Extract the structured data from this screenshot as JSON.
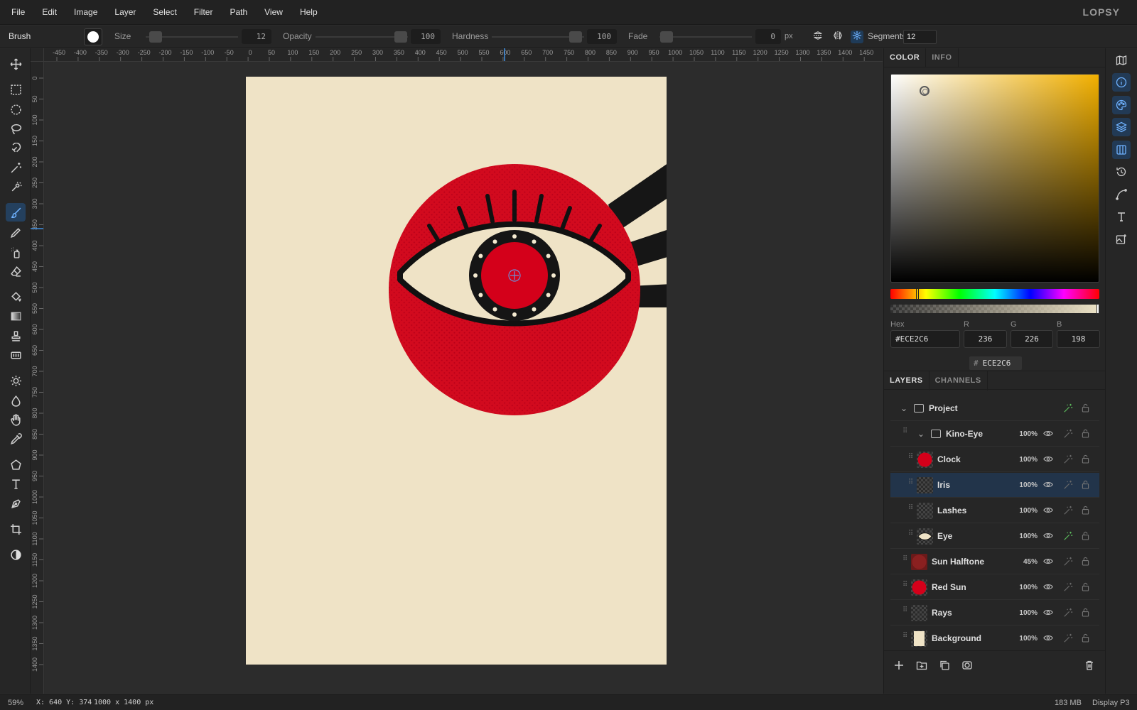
{
  "app": {
    "logo": "LOPSY"
  },
  "menu": [
    "File",
    "Edit",
    "Image",
    "Layer",
    "Select",
    "Filter",
    "Path",
    "View",
    "Help"
  ],
  "options_bar": {
    "tool_name": "Brush",
    "size_label": "Size",
    "size_value": "12",
    "opacity_label": "Opacity",
    "opacity_value": "100",
    "hardness_label": "Hardness",
    "hardness_value": "100",
    "fade_label": "Fade",
    "fade_value": "0",
    "fade_unit": "px",
    "segments_label": "Segments",
    "segments_value": "12",
    "symmetry_icons": [
      "symmetry-vertical-icon",
      "symmetry-horizontal-icon",
      "symmetry-radial-icon"
    ]
  },
  "tools": [
    "move-icon",
    "rect-select-icon",
    "ellipse-select-icon",
    "lasso-icon",
    "magnetic-lasso-icon",
    "magic-wand-icon",
    "quick-select-icon",
    "brush-icon",
    "pencil-icon",
    "spray-icon",
    "eraser-icon",
    "bucket-icon",
    "gradient-icon",
    "stamp-icon",
    "pattern-icon",
    "dodge-icon",
    "blur-drop-icon",
    "smudge-hand-icon",
    "eyedropper-icon",
    "polygon-icon",
    "text-icon",
    "pen-icon",
    "crop-icon",
    "contrast-icon"
  ],
  "ruler": {
    "h_labels": [
      "-450",
      "-400",
      "-350",
      "-300",
      "-250",
      "-200",
      "-150",
      "-100",
      "-50",
      "0",
      "50",
      "100",
      "150",
      "200",
      "250",
      "300",
      "350",
      "400",
      "450",
      "500",
      "550",
      "600",
      "650",
      "700",
      "750",
      "800",
      "850",
      "900",
      "950",
      "1000",
      "1050",
      "1100",
      "1150",
      "1200",
      "1250",
      "1300",
      "1350",
      "1400",
      "1450"
    ],
    "v_labels": [
      "0",
      "50",
      "100",
      "150",
      "200",
      "250",
      "300",
      "350",
      "400",
      "450",
      "500",
      "550",
      "600",
      "650",
      "700",
      "750",
      "800",
      "850",
      "900",
      "950",
      "1000",
      "1050",
      "1100",
      "1150",
      "1200",
      "1250",
      "1300",
      "1350",
      "1400"
    ]
  },
  "color_panel": {
    "tabs": [
      "COLOR",
      "INFO"
    ],
    "hex_label": "Hex",
    "hex_value": "#ECE2C6",
    "r_label": "R",
    "r_value": "236",
    "g_label": "G",
    "g_value": "226",
    "b_label": "B",
    "b_value": "198",
    "chip_hash": "#",
    "chip_value": "ECE2C6",
    "color": "#ECE2C6"
  },
  "layers_panel": {
    "tabs": [
      "LAYERS",
      "CHANNELS"
    ],
    "layers": [
      {
        "name": "Project",
        "opacity": "",
        "type": "group",
        "depth": 0,
        "fx": true,
        "visible_icon": false
      },
      {
        "name": "Kino-Eye",
        "opacity": "100%",
        "type": "group",
        "depth": 1,
        "fx": false,
        "visible_icon": true
      },
      {
        "name": "Clock",
        "opacity": "100%",
        "type": "layer",
        "depth": 2,
        "fx": false,
        "thumb": "red-circle",
        "visible_icon": true
      },
      {
        "name": "Iris",
        "opacity": "100%",
        "type": "layer",
        "depth": 2,
        "fx": false,
        "thumb": "transparent",
        "selected": true,
        "visible_icon": true
      },
      {
        "name": "Lashes",
        "opacity": "100%",
        "type": "layer",
        "depth": 2,
        "fx": false,
        "thumb": "transparent",
        "visible_icon": true
      },
      {
        "name": "Eye",
        "opacity": "100%",
        "type": "layer",
        "depth": 2,
        "fx": true,
        "thumb": "eye-shape",
        "visible_icon": true
      },
      {
        "name": "Sun Halftone",
        "opacity": "45%",
        "type": "layer",
        "depth": 1,
        "fx": false,
        "thumb": "halftone",
        "visible_icon": true
      },
      {
        "name": "Red Sun",
        "opacity": "100%",
        "type": "layer",
        "depth": 1,
        "fx": false,
        "thumb": "red-circle",
        "visible_icon": true
      },
      {
        "name": "Rays",
        "opacity": "100%",
        "type": "layer",
        "depth": 1,
        "fx": false,
        "thumb": "transparent",
        "visible_icon": true
      },
      {
        "name": "Background",
        "opacity": "100%",
        "type": "layer",
        "depth": 1,
        "fx": false,
        "thumb": "cream",
        "visible_icon": true
      }
    ],
    "footer_icons": [
      "add-layer-icon",
      "add-folder-icon",
      "duplicate-layer-icon",
      "mask-icon",
      "delete-layer-icon"
    ]
  },
  "right_strip": [
    "map-icon",
    "info-icon",
    "palette-icon",
    "layers-icon",
    "columns-icon",
    "history-icon",
    "curve-icon",
    "type-icon",
    "image-add-icon"
  ],
  "status": {
    "zoom": "59%",
    "coords": "X: 640 Y: 374",
    "doc_size": "1000 x 1400 px",
    "memory": "183 MB",
    "profile": "Display P3"
  },
  "colors": {
    "accent": "#4a9eff",
    "canvas": "#efe3c6",
    "sun_red": "#d4001a"
  }
}
